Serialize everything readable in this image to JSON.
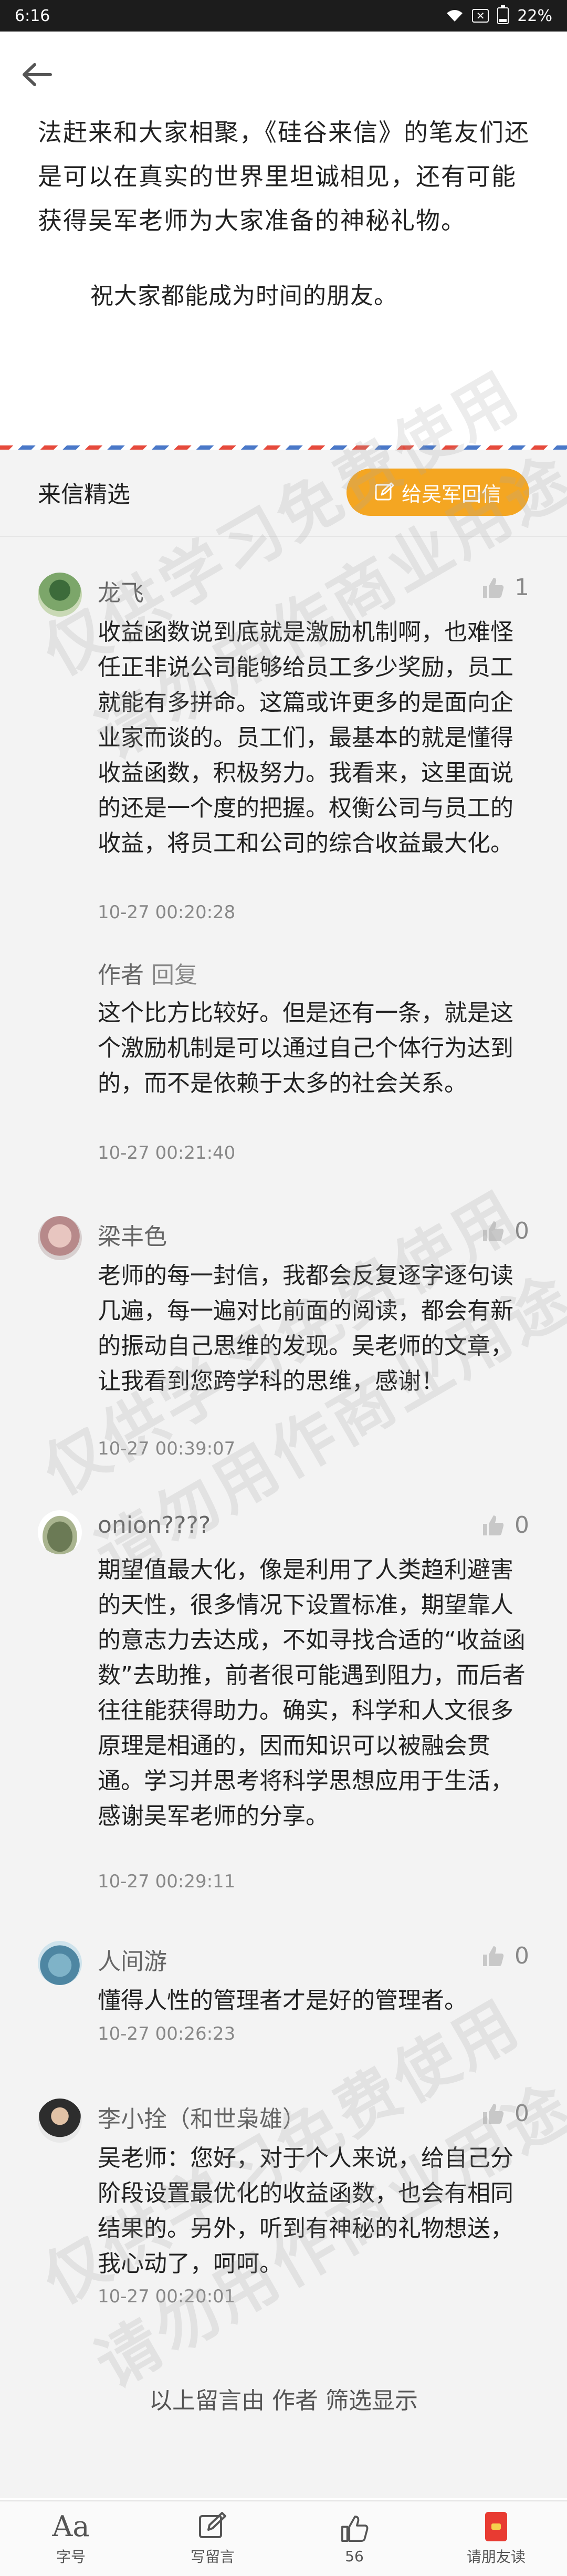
{
  "status_bar": {
    "time": "6:16",
    "battery": "22%",
    "battery_level": 0.22
  },
  "article": {
    "para1": "法赶来和大家相聚，《硅谷来信》的笔友们还是可以在真实的世界里坦诚相见，还有可能获得吴军老师为大家准备的神秘礼物。",
    "para2": "祝大家都能成为时间的朋友。"
  },
  "letters": {
    "title": "来信精选",
    "reply_button": "给吴军回信"
  },
  "comments": [
    {
      "name": "龙飞",
      "likes": "1",
      "text": "收益函数说到底就是激励机制啊，也难怪任正非说公司能够给员工多少奖励，员工就能有多拼命。这篇或许更多的是面向企业家而谈的。员工们，最基本的就是懂得收益函数，积极努力。我看来，这里面说的还是一个度的把握。权衡公司与员工的收益，将员工和公司的综合收益最大化。",
      "time": "10-27 00:20:28",
      "author_reply": {
        "label": "作者",
        "action": "回复",
        "text": "这个比方比较好。但是还有一条，就是这个激励机制是可以通过自己个体行为达到的，而不是依赖于太多的社会关系。",
        "time": "10-27 00:21:40"
      }
    },
    {
      "name": "梁丰色",
      "likes": "0",
      "text": "老师的每一封信，我都会反复逐字逐句读几遍，每一遍对比前面的阅读，都会有新的振动自己思维的发现。吴老师的文章，让我看到您跨学科的思维，感谢！",
      "time": "10-27 00:39:07"
    },
    {
      "name": "onion????",
      "likes": "0",
      "text": "期望值最大化，像是利用了人类趋利避害的天性，很多情况下设置标准，期望靠人的意志力去达成，不如寻找合适的“收益函数”去助推，前者很可能遇到阻力，而后者往往能获得助力。确实，科学和人文很多原理是相通的，因而知识可以被融会贯通。学习并思考将科学思想应用于生活，感谢吴军老师的分享。",
      "time": "10-27 00:29:11"
    },
    {
      "name": "人间游",
      "likes": "0",
      "text": "懂得人性的管理者才是好的管理者。",
      "time": "10-27 00:26:23"
    },
    {
      "name": "李小拴（和世枭雄）",
      "likes": "0",
      "text": "吴老师：您好，对于个人来说，给自己分阶段设置最优化的收益函数，也会有相同结果的。另外，听到有神秘的礼物想送，我心动了，呵呵。",
      "time": "10-27 00:20:01"
    }
  ],
  "footer_note": "以上留言由 作者 筛选显示",
  "bottom_bar": {
    "font_label": "字号",
    "font_glyph": "Aa",
    "write_label": "写留言",
    "like_label": "56",
    "invite_label": "请朋友读"
  },
  "watermark": {
    "line1": "仅供学习免费使用",
    "line2": "请勿用作商业用途"
  },
  "colors": {
    "accent": "#f4a622",
    "background": "#f3f3f3",
    "status_bar": "#1c1c1c"
  }
}
